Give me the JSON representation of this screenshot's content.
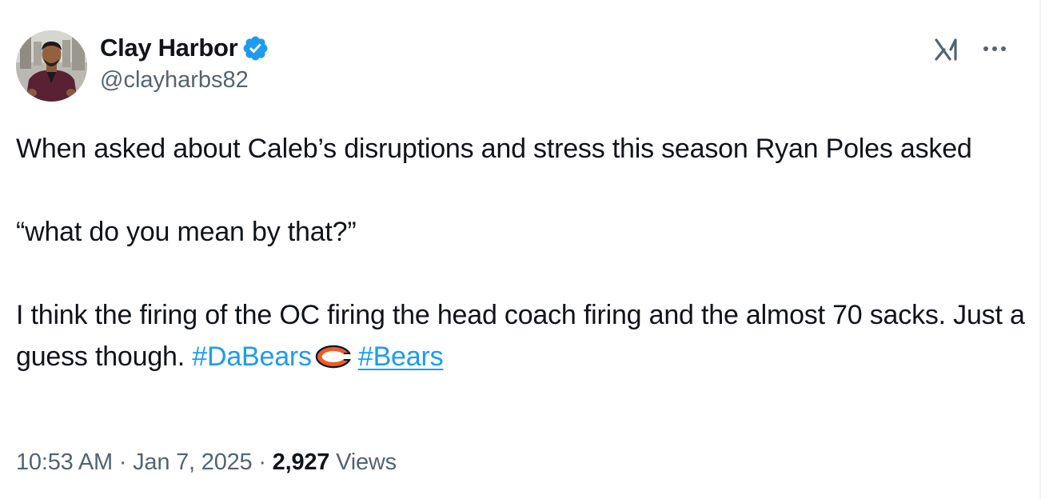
{
  "author": {
    "display_name": "Clay Harbor",
    "handle": "@clayharbs82",
    "verified": true,
    "verified_color": "#1d9bf0"
  },
  "tweet": {
    "line1": "When asked about Caleb’s disruptions and stress this season Ryan Poles asked",
    "quote": "“what do you mean by that?”",
    "line3": "I think the firing of the OC firing the head coach firing and the almost 70 sacks. Just a guess though. ",
    "hashtag1": "#DaBears",
    "hashtag2": "#Bears",
    "hashtag_color": "#1d9bf0",
    "inline_logo": "bears-c-logo-icon"
  },
  "meta": {
    "time": "10:53 AM",
    "separator1": " · ",
    "date": "Jan 7, 2025",
    "separator2": " · ",
    "views_count": "2,927",
    "views_label": " Views"
  },
  "icons": {
    "grok": "grok-icon",
    "more": "more-options-icon",
    "verified": "verified-badge-icon"
  }
}
